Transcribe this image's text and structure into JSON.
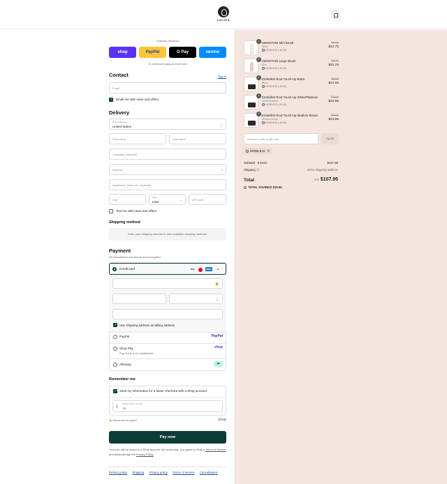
{
  "brand": {
    "logo_text": "CALISTA"
  },
  "express": {
    "title": "Express checkout",
    "buttons": [
      {
        "label": "shop",
        "color": "#5a31f4"
      },
      {
        "label": "PayPal",
        "color": "#ffc439"
      },
      {
        "label": "G Pay",
        "color": "#000000"
      },
      {
        "label": "venmo",
        "color": "#008cff"
      }
    ],
    "divider": "Or checkout using a credit card"
  },
  "contact": {
    "title": "Contact",
    "signin": "Sign in",
    "email_placeholder": "Email",
    "email_news": "Email me with news and offers"
  },
  "delivery": {
    "title": "Delivery",
    "country_label": "Country/Region",
    "country_value": "United States",
    "first_name": "First name",
    "last_name": "Last name",
    "company": "Company (optional)",
    "address": "Address",
    "apartment": "Apartment, suite, etc. (optional)",
    "city": "City",
    "state_label": "State",
    "state_value": "Iowa",
    "zip": "ZIP code",
    "text_news": "Text me with news and offers"
  },
  "shipping_method": {
    "title": "Shipping method",
    "note": "Enter your shipping address to view available shipping methods."
  },
  "payment": {
    "title": "Payment",
    "subtitle": "All transactions are secure and encrypted.",
    "credit_card": "Credit card",
    "card_badges": [
      "VISA",
      "MC",
      "AMEX",
      "+5"
    ],
    "billing_same": "Use shipping address as billing address",
    "paypal": "PayPal",
    "paypal_logo": "PayPal",
    "shop_pay": "Shop Pay",
    "shop_pay_sub": "Pay in full or in installments",
    "shop_pay_logo": "shop",
    "afterpay": "Afterpay"
  },
  "remember": {
    "title": "Remember me",
    "save_info": "Save my information for a faster checkout with a Shop account",
    "phone_label": "Mobile phone number",
    "phone_value": "+1",
    "secure": "Secure and encrypted",
    "shop_logo": "shop"
  },
  "pay_now": "Pay now",
  "legal": {
    "text1": "Your info will be saved to a Shop account. By continuing, you agree to Shop's",
    "terms": "Terms of Service",
    "text2": "and acknowledge the",
    "privacy": "Privacy Policy"
  },
  "footer_links": [
    "Refund policy",
    "Shipping",
    "Privacy policy",
    "Terms of service",
    "Cancellations"
  ],
  "cart": {
    "items": [
      {
        "qty": "1",
        "name": "SMOOTHIE Mini Brush",
        "variant": "White",
        "discount": "MOBILE15 (-$2.25)",
        "old": "$15.00",
        "price": "$12.75",
        "kind": "brush",
        "color": "#f3ecea"
      },
      {
        "qty": "1",
        "name": "SMOOTHIE Large Brush",
        "variant": "Pink",
        "discount": "MOBILE15 (-$3.75)",
        "old": "$25.00",
        "price": "$21.25",
        "kind": "brush",
        "color": "#f0c9c2"
      },
      {
        "qty": "1",
        "name": "Embellish Root Touch-Up Black",
        "variant": "Black",
        "discount": "MOBILE15 (-$4.35)",
        "old": "$29.00",
        "price": "$24.65",
        "kind": "tube",
        "color": "#2a2a2a"
      },
      {
        "qty": "1",
        "name": "Embellish Root Touch-Up White/Platinum",
        "variant": "White/Platinum",
        "discount": "MOBILE15 (-$4.35)",
        "old": "$29.00",
        "price": "$24.65",
        "kind": "tube",
        "color": "#2a2a2a"
      },
      {
        "qty": "1",
        "name": "Embellish Root Touch-Up Medium Brown",
        "variant": "Medium Brown",
        "discount": "MOBILE15 (-$4.35)",
        "old": "$29.00",
        "price": "$24.65",
        "kind": "tube",
        "color": "#2a2a2a"
      }
    ],
    "discount_placeholder": "Discount code or gift card",
    "apply": "Apply",
    "applied_code": "MOBILE15",
    "subtotal_label": "Subtotal · 5 items",
    "subtotal_value": "$107.95",
    "shipping_label": "Shipping",
    "shipping_value": "Enter shipping address",
    "total_label": "Total",
    "currency": "USD",
    "total_value": "$107.95",
    "savings_label": "TOTAL SAVINGS",
    "savings_value": "$19.05"
  }
}
